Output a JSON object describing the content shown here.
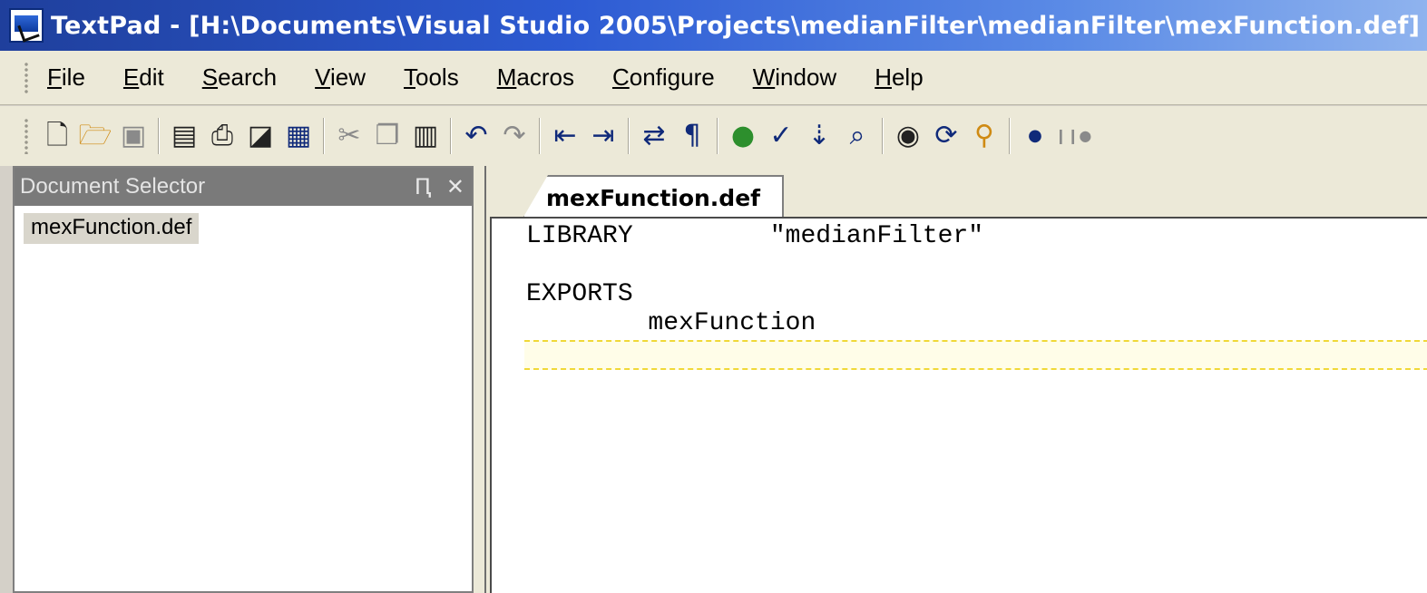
{
  "window": {
    "title": "TextPad - [H:\\Documents\\Visual Studio 2005\\Projects\\medianFilter\\medianFilter\\mexFunction.def]"
  },
  "menu": [
    {
      "name": "menu-file",
      "mnemonic": "F",
      "rest": "ile"
    },
    {
      "name": "menu-edit",
      "mnemonic": "E",
      "rest": "dit"
    },
    {
      "name": "menu-search",
      "mnemonic": "S",
      "rest": "earch"
    },
    {
      "name": "menu-view",
      "mnemonic": "V",
      "rest": "iew"
    },
    {
      "name": "menu-tools",
      "mnemonic": "T",
      "rest": "ools"
    },
    {
      "name": "menu-macros",
      "mnemonic": "M",
      "rest": "acros"
    },
    {
      "name": "menu-configure",
      "mnemonic": "C",
      "rest": "onfigure"
    },
    {
      "name": "menu-window",
      "mnemonic": "W",
      "rest": "indow"
    },
    {
      "name": "menu-help",
      "mnemonic": "H",
      "rest": "elp"
    }
  ],
  "toolbar": {
    "icons": [
      "new-file-icon",
      "open-folder-icon",
      "save-icon",
      "save-all-icon",
      "print-icon",
      "print-preview-icon",
      "workspace-icon",
      "cut-icon",
      "copy-icon",
      "paste-icon",
      "undo-icon",
      "redo-icon",
      "indent-icon",
      "outdent-icon",
      "word-wrap-icon",
      "show-paragraph-icon",
      "web-browser-icon",
      "spell-check-icon",
      "sort-icon",
      "find-in-files-icon",
      "view-find-icon",
      "find-replace-icon",
      "find-binoculars-icon",
      "record-macro-icon",
      "pause-macro-icon"
    ]
  },
  "document_selector": {
    "title": "Document Selector",
    "pin_glyph": "Ԥ",
    "close_glyph": "✕",
    "items": [
      "mexFunction.def"
    ]
  },
  "editor": {
    "tab_label": "mexFunction.def",
    "lines": [
      "LIBRARY         \"medianFilter\"",
      "",
      "EXPORTS",
      "        mexFunction"
    ]
  }
}
